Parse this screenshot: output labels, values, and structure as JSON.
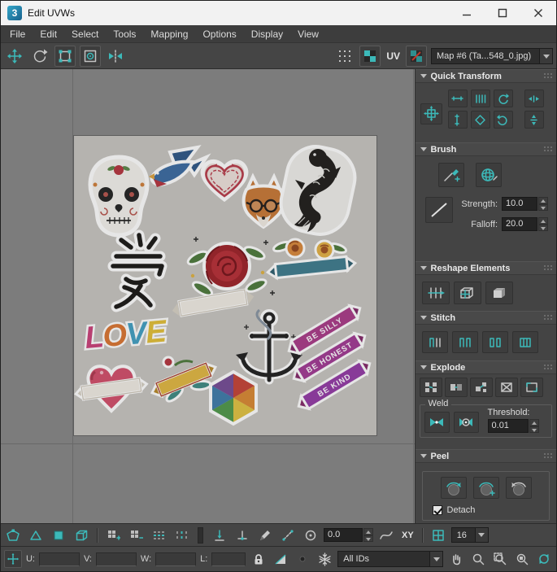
{
  "window": {
    "title": "Edit UVWs",
    "logo_text": "3"
  },
  "menu": {
    "items": [
      "File",
      "Edit",
      "Select",
      "Tools",
      "Mapping",
      "Options",
      "Display",
      "View"
    ]
  },
  "toolbar": {
    "uv_label": "UV",
    "map_dropdown_value": "Map #6 (Ta...548_0.jpg)"
  },
  "canvas": {
    "image": {
      "love_letters": [
        "L",
        "O",
        "V",
        "E"
      ],
      "kanji_label": "愛",
      "ribbon_texts": [
        "BE SILLY",
        "BE HONEST",
        "BE KIND"
      ]
    }
  },
  "panel": {
    "quick_transform": {
      "title": "Quick Transform"
    },
    "brush": {
      "title": "Brush",
      "strength_label": "Strength:",
      "strength_value": "10.0",
      "falloff_label": "Falloff:",
      "falloff_value": "20.0"
    },
    "reshape": {
      "title": "Reshape Elements"
    },
    "stitch": {
      "title": "Stitch"
    },
    "explode": {
      "title": "Explode",
      "weld_label": "Weld",
      "threshold_label": "Threshold:",
      "threshold_value": "0.01"
    },
    "peel": {
      "title": "Peel",
      "detach_label": "Detach",
      "detach_checked": true
    }
  },
  "bottom_toolbar": {
    "angle_value": "0.0",
    "axis_label": "XY",
    "grid_value": "16"
  },
  "status_bar": {
    "u_label": "U:",
    "v_label": "V:",
    "w_label": "W:",
    "l_label": "L:",
    "ids_value": "All IDs"
  },
  "colors": {
    "accent_teal": "#3cb9b9",
    "panel_bg": "#444444",
    "canvas_bg": "#7c7c7c"
  }
}
